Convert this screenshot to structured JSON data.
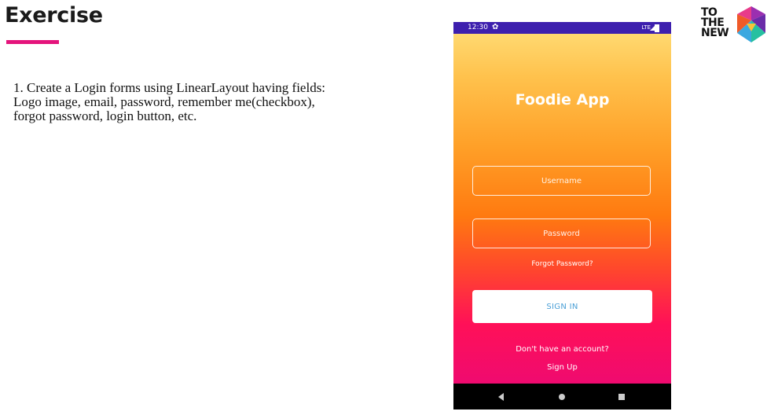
{
  "slide": {
    "title": "Exercise",
    "exercise_text": "1. Create a Login forms using LinearLayout having fields: Logo image, email, password, remember me(checkbox), forgot password, login button, etc.",
    "accent_color": "#e4147c"
  },
  "brand": {
    "logo_lines": [
      "TO",
      "THE",
      "NEW"
    ],
    "icon": "faceted-gem-logo-icon"
  },
  "phone": {
    "status_bar": {
      "time": "12:30",
      "network": "LTE",
      "icons": [
        "gear-icon",
        "signal-icon",
        "battery-icon"
      ],
      "color": "#3d1fae"
    },
    "app_title": "Foodie App",
    "username_placeholder": "Username",
    "password_placeholder": "Password",
    "forgot_password": "Forgot Password?",
    "sign_in_label": "SIGN IN",
    "no_account_text": "Don't have an account?",
    "sign_up_label": "Sign Up",
    "nav_icons": [
      "back-icon",
      "home-icon",
      "recent-apps-icon"
    ]
  }
}
